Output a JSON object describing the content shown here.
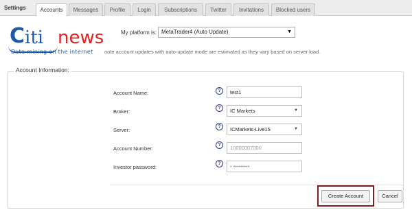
{
  "tabs": {
    "heading": "Settings",
    "items": [
      "Accounts",
      "Messages",
      "Profile",
      "Login",
      "Subscriptions",
      "Twitter",
      "Invitations",
      "Blocked users"
    ],
    "active": "Accounts"
  },
  "watermark": {
    "brand_a": "iti",
    "brand_b": "news",
    "initial": "C",
    "tagline": "Data mining on the internet"
  },
  "platform": {
    "label": "My platform is:",
    "selected": "MetaTrader4 (Auto Update)",
    "note": "note account updates with auto-update mode are estimated as they vary based on server load."
  },
  "account": {
    "legend": "Account Information:",
    "fields": {
      "name": {
        "label": "Account Name:",
        "value": "test1"
      },
      "broker": {
        "label": "Broker:",
        "value": "IC Markets"
      },
      "server": {
        "label": "Server:",
        "value": "ICMarkets-Live15"
      },
      "number": {
        "label": "Account Number:",
        "value": "10000007000"
      },
      "investor": {
        "label": "Investor password:",
        "value": "• •••••••••"
      }
    }
  },
  "actions": {
    "create": "Create Account",
    "cancel": "Cancel"
  },
  "icons": {
    "help": "?",
    "dropdown": "▼"
  },
  "colors": {
    "highlight": "#7a1f1f",
    "help": "#2e3a8a",
    "brand_blue": "#1e5aa8",
    "brand_red": "#e02020"
  }
}
